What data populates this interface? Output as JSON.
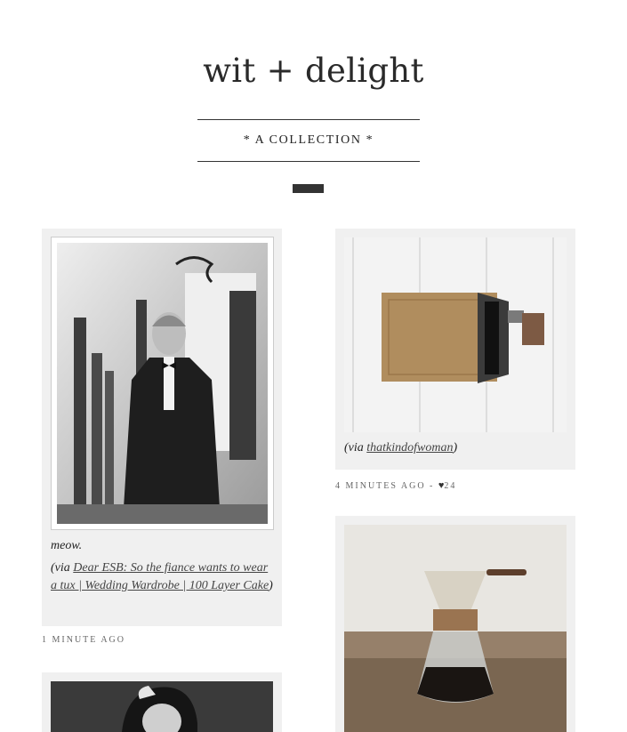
{
  "blog": {
    "title": "wit + delight",
    "subtitle": "* A COLLECTION *"
  },
  "posts": [
    {
      "image_alt": "black and white photo of man in tuxedo",
      "caption": "meow.",
      "via_prefix": "(via ",
      "via_link": "Dear ESB: So the fiance wants to wear a tux | Wedding Wardrobe | 100 Layer Cake",
      "via_suffix": ")",
      "time": "1 MINUTE AGO"
    },
    {
      "image_alt": "cardboard sleeve with phone",
      "via_prefix": "(via ",
      "via_link": "thatkindofwoman",
      "via_suffix": ")",
      "time": "4 MINUTES AGO - ",
      "likes": "24"
    },
    {
      "image_alt": "coffee chemex on wooden table"
    },
    {
      "image_alt": "black and white portrait of woman"
    }
  ],
  "colors": {
    "card_bg": "#f0f0f0",
    "text": "#222222",
    "accent_bar": "#333333"
  }
}
